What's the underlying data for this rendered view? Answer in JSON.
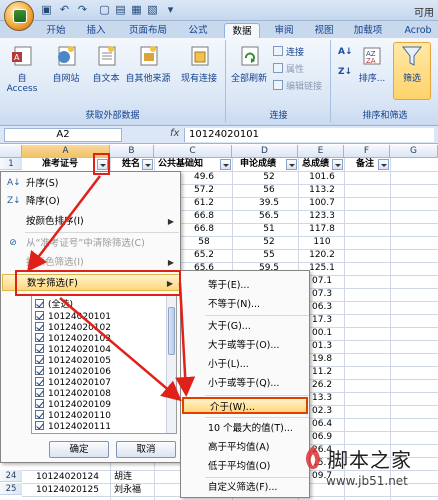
{
  "app_title": "可用",
  "ribbon_tabs": [
    "开始",
    "插入",
    "页面布局",
    "公式",
    "数据",
    "审阅",
    "视图",
    "加载项",
    "Acrob"
  ],
  "ribbon": {
    "external_data": {
      "label": "获取外部数据",
      "buttons": [
        "自 Access",
        "自网站",
        "自文本",
        "自其他来源",
        "现有连接"
      ]
    },
    "connections": {
      "label": "连接",
      "refresh": "全部刷新",
      "small": [
        "连接",
        "属性",
        "编辑链接"
      ]
    },
    "sort_filter": {
      "label": "排序和筛选",
      "sort": "排序...",
      "filter": "筛选"
    }
  },
  "formula_bar": {
    "name_box": "A2",
    "fx": "fx",
    "value": "10124020101"
  },
  "columns": [
    "A",
    "B",
    "C",
    "D",
    "E",
    "F",
    "G"
  ],
  "headers": [
    "准考证号",
    "姓名",
    "公共基础知",
    "申论成绩",
    "总成绩",
    "备注"
  ],
  "visible_rows": [
    {
      "c": "49.6",
      "d": "52",
      "e": "101.6"
    },
    {
      "c": "57.2",
      "d": "56",
      "e": "113.2"
    },
    {
      "c": "61.2",
      "d": "39.5",
      "e": "100.7"
    },
    {
      "c": "66.8",
      "d": "56.5",
      "e": "123.3"
    },
    {
      "c": "66.8",
      "d": "51",
      "e": "117.8"
    },
    {
      "c": "58",
      "d": "52",
      "e": "110"
    },
    {
      "c": "65.2",
      "d": "55",
      "e": "120.2"
    },
    {
      "c": "65.6",
      "d": "59.5",
      "e": "125.1"
    }
  ],
  "right_edge_values": [
    "07.1",
    "07.3",
    "06.3",
    "17.3",
    "00.1",
    "01.3",
    "19.8",
    "11.2",
    "26.2",
    "13.3",
    "02.3",
    "06.4",
    "06.9",
    "26.4",
    "15.7",
    "09.7"
  ],
  "bottom_rows": [
    {
      "row": "24",
      "a": "10124020124",
      "b": "胡连"
    },
    {
      "row": "25",
      "a": "10124020125",
      "b": "刘永福"
    }
  ],
  "filter_menu": {
    "items": [
      "升序(S)",
      "降序(O)",
      "按颜色排序(I)",
      "从“准考证号”中清除筛选(C)",
      "按颜色筛选(I)",
      "数字筛选(F)"
    ],
    "checklist": [
      "(全选)",
      "10124020101",
      "10124020102",
      "10124020103",
      "10124020104",
      "10124020105",
      "10124020106",
      "10124020107",
      "10124020108",
      "10124020109",
      "10124020110",
      "10124020111"
    ],
    "ok": "确定",
    "cancel": "取消"
  },
  "number_filter_submenu": [
    "等于(E)...",
    "不等于(N)...",
    "大于(G)...",
    "大于或等于(O)...",
    "小于(L)...",
    "小于或等于(Q)...",
    "介于(W)...",
    "10 个最大的值(T)...",
    "高于平均值(A)",
    "低于平均值(O)",
    "自定义筛选(F)..."
  ],
  "watermark": {
    "title": "脚本之家",
    "url": "www.jb51.net"
  },
  "colors": {
    "highlight": "#ffd77a",
    "annotation_red": "#e0211a"
  }
}
